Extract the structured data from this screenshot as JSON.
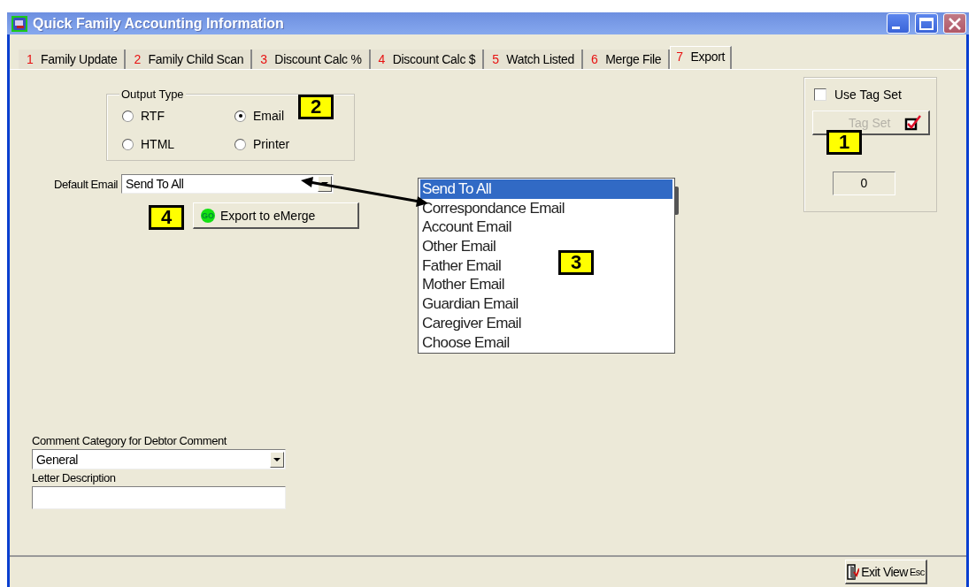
{
  "window": {
    "title": "Quick Family Accounting Information"
  },
  "tabs": [
    {
      "number": "1",
      "label": "Family Update",
      "selected": false
    },
    {
      "number": "2",
      "label": "Family Child Scan",
      "selected": false
    },
    {
      "number": "3",
      "label": "Discount Calc %",
      "selected": false
    },
    {
      "number": "4",
      "label": "Discount Calc $",
      "selected": false
    },
    {
      "number": "5",
      "label": "Watch Listed",
      "selected": false
    },
    {
      "number": "6",
      "label": "Merge File",
      "selected": false
    },
    {
      "number": "7",
      "label": "Export",
      "selected": true
    }
  ],
  "output_type": {
    "legend": "Output Type",
    "callout": "2",
    "options": [
      {
        "label": "RTF",
        "selected": false
      },
      {
        "label": "Email",
        "selected": true
      },
      {
        "label": "HTML",
        "selected": false
      },
      {
        "label": "Printer",
        "selected": false
      }
    ]
  },
  "default_email": {
    "label": "Default Email",
    "value": "Send To All"
  },
  "export_button": {
    "label": "Export to eMerge",
    "icon_text": "GO",
    "callout": "4"
  },
  "email_list": {
    "callout": "3",
    "items": [
      {
        "label": "Send To All",
        "selected": true
      },
      {
        "label": "Correspondance Email",
        "selected": false
      },
      {
        "label": "Account Email",
        "selected": false
      },
      {
        "label": "Other Email",
        "selected": false
      },
      {
        "label": "Father Email",
        "selected": false
      },
      {
        "label": "Mother Email",
        "selected": false
      },
      {
        "label": "Guardian Email",
        "selected": false
      },
      {
        "label": "Caregiver Email",
        "selected": false
      },
      {
        "label": "Choose Email",
        "selected": false
      }
    ]
  },
  "tag_set": {
    "use_checkbox": {
      "label": "Use Tag Set",
      "checked": false
    },
    "button": {
      "label": "Tag Set",
      "disabled": true
    },
    "count": "0",
    "callout": "1"
  },
  "comment_category": {
    "label": "Comment Category for Debtor Comment",
    "value": "General"
  },
  "letter_description": {
    "label": "Letter Description"
  },
  "exit_button": {
    "label": "Exit View",
    "shortcut": "Esc"
  }
}
